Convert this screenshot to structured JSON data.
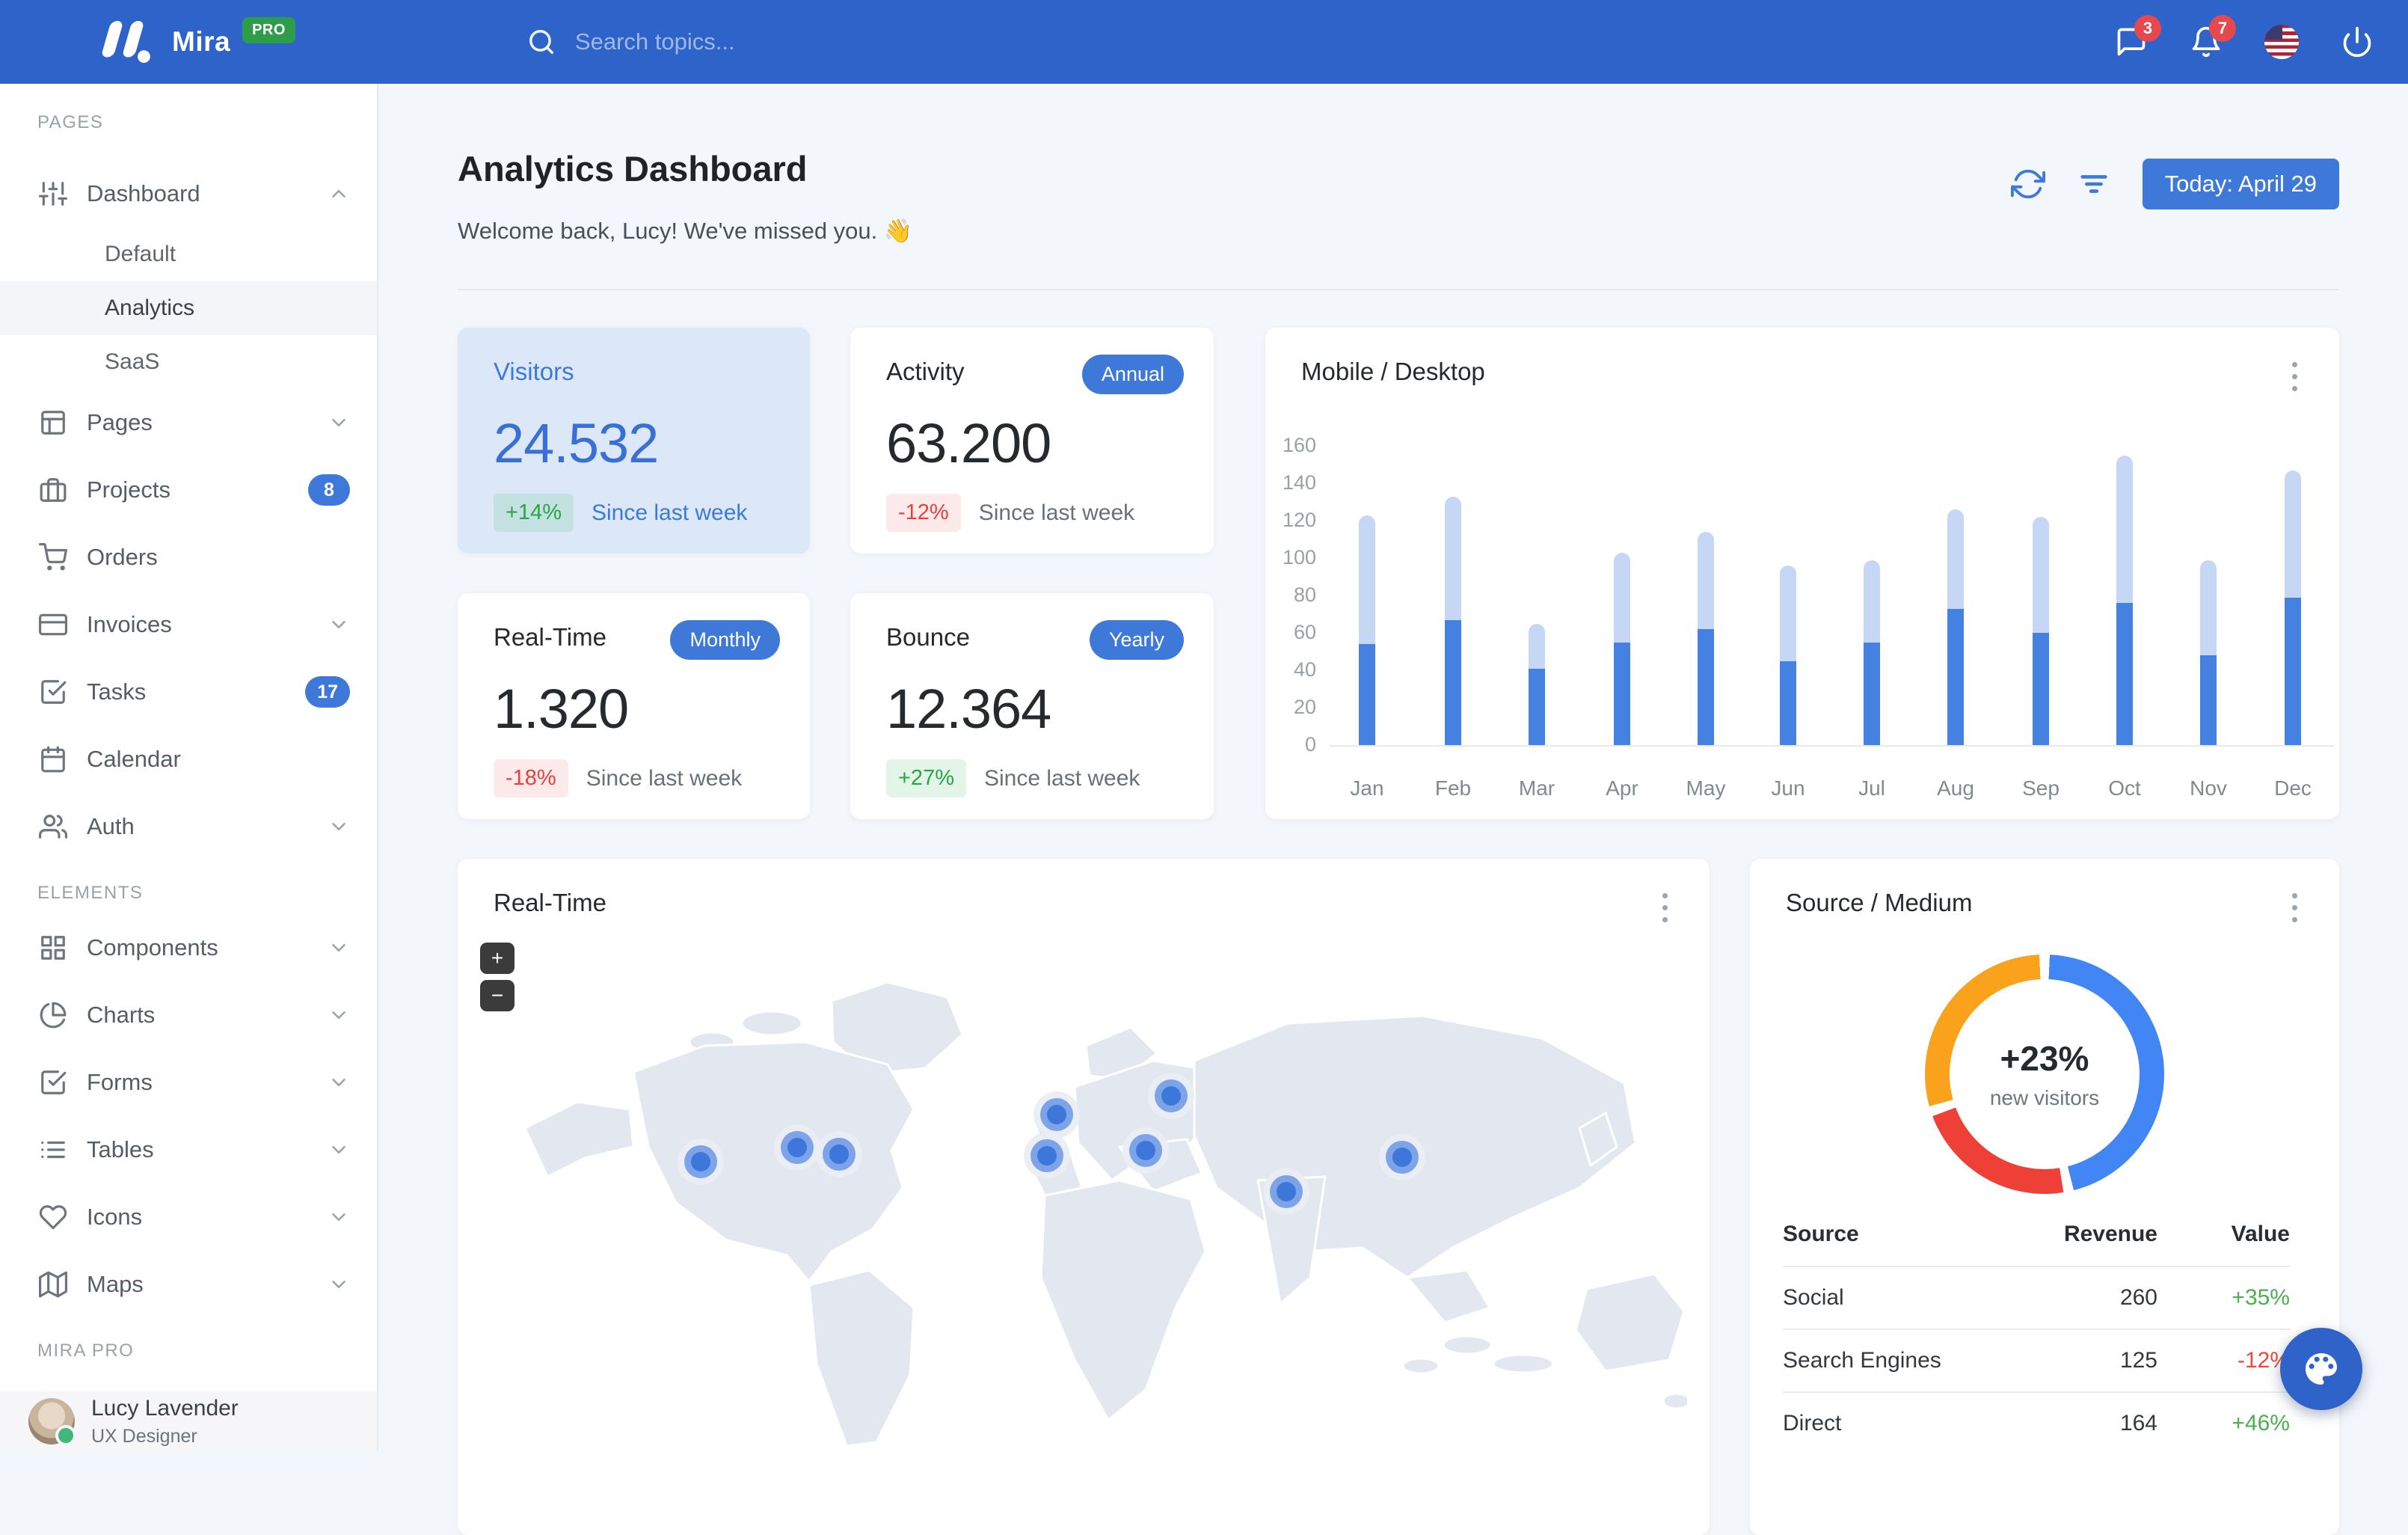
{
  "colors": {
    "navbar": "#2E63C9",
    "primary": "#3E79DA",
    "badge_red": "#E5484D",
    "pro_green": "#2E9D49",
    "positive_green": "#2AA444",
    "negative_red": "#E5413E",
    "table_green": "#4CAF50",
    "table_red": "#EF4837",
    "bar_mobile": "#4581E1",
    "bar_desktop": "#C5D7F4",
    "donut_blue": "#4285F4",
    "donut_red": "#EF4037",
    "donut_orange": "#FAA21B",
    "highlight_card_bg": "#DCE8F8",
    "map_fill": "#E3E8F0"
  },
  "navbar": {
    "brand": "Mira",
    "brand_badge": "PRO",
    "search_placeholder": "Search topics...",
    "messages_badge": "3",
    "notifications_badge": "7",
    "icons": [
      "search-icon",
      "message-square-icon",
      "bell-icon",
      "us-flag-icon",
      "power-icon"
    ]
  },
  "sidebar": {
    "sections": [
      {
        "title": "PAGES",
        "items": [
          {
            "label": "Dashboard",
            "icon": "sliders",
            "expanded": true,
            "children": [
              {
                "label": "Default",
                "active": false
              },
              {
                "label": "Analytics",
                "active": true
              },
              {
                "label": "SaaS",
                "active": false
              }
            ]
          },
          {
            "label": "Pages",
            "icon": "layout",
            "chevron": "down"
          },
          {
            "label": "Projects",
            "icon": "briefcase",
            "badge": "8"
          },
          {
            "label": "Orders",
            "icon": "shopping-cart"
          },
          {
            "label": "Invoices",
            "icon": "credit-card",
            "chevron": "down"
          },
          {
            "label": "Tasks",
            "icon": "check-square",
            "badge": "17"
          },
          {
            "label": "Calendar",
            "icon": "calendar"
          },
          {
            "label": "Auth",
            "icon": "users",
            "chevron": "down"
          }
        ]
      },
      {
        "title": "ELEMENTS",
        "items": [
          {
            "label": "Components",
            "icon": "grid",
            "chevron": "down"
          },
          {
            "label": "Charts",
            "icon": "pie-chart",
            "chevron": "down"
          },
          {
            "label": "Forms",
            "icon": "check-square",
            "chevron": "down"
          },
          {
            "label": "Tables",
            "icon": "list",
            "chevron": "down"
          },
          {
            "label": "Icons",
            "icon": "heart",
            "chevron": "down"
          },
          {
            "label": "Maps",
            "icon": "map",
            "chevron": "down"
          }
        ]
      },
      {
        "title": "MIRA PRO",
        "items": []
      }
    ],
    "user": {
      "name": "Lucy Lavender",
      "role": "UX Designer",
      "status": "online"
    }
  },
  "header": {
    "title": "Analytics Dashboard",
    "subtitle": "Welcome back, Lucy! We've missed you. 👋",
    "date_button": "Today: April 29",
    "icons": [
      "refresh-icon",
      "filter-icon"
    ]
  },
  "stats": [
    {
      "title": "Visitors",
      "value": "24.532",
      "badge": "",
      "delta": "+14%",
      "delta_type": "positive",
      "caption": "Since last week",
      "variant": "highlight"
    },
    {
      "title": "Activity",
      "value": "63.200",
      "badge": "Annual",
      "delta": "-12%",
      "delta_type": "negative",
      "caption": "Since last week",
      "variant": "default"
    },
    {
      "title": "Real-Time",
      "value": "1.320",
      "badge": "Monthly",
      "delta": "-18%",
      "delta_type": "negative",
      "caption": "Since last week",
      "variant": "default"
    },
    {
      "title": "Bounce",
      "value": "12.364",
      "badge": "Yearly",
      "delta": "+27%",
      "delta_type": "positive",
      "caption": "Since last week",
      "variant": "default"
    }
  ],
  "chart_data": [
    {
      "type": "bar",
      "stacked": true,
      "title": "Mobile / Desktop",
      "categories": [
        "Jan",
        "Feb",
        "Mar",
        "Apr",
        "May",
        "Jun",
        "Jul",
        "Aug",
        "Sep",
        "Oct",
        "Nov",
        "Dec"
      ],
      "series": [
        {
          "name": "Mobile",
          "color": "#4581E1",
          "values": [
            54,
            67,
            41,
            55,
            62,
            45,
            55,
            73,
            60,
            76,
            48,
            79
          ]
        },
        {
          "name": "Desktop",
          "color": "#C5D7F4",
          "values": [
            69,
            66,
            24,
            48,
            52,
            51,
            44,
            53,
            62,
            79,
            51,
            68
          ]
        }
      ],
      "xlabel": "",
      "ylabel": "",
      "ylim": [
        0,
        160
      ],
      "yticks": [
        0,
        20,
        40,
        60,
        80,
        100,
        120,
        140,
        160
      ],
      "grid": false,
      "legend": "none"
    },
    {
      "type": "pie",
      "subtype": "donut",
      "title": "Source / Medium",
      "center_value": "+23%",
      "center_label": "new visitors",
      "segments": [
        {
          "label": "Social",
          "value": 260,
          "color": "#4285F4"
        },
        {
          "label": "Search Engines",
          "value": 125,
          "color": "#EF4037"
        },
        {
          "label": "Direct",
          "value": 164,
          "color": "#FAA21B"
        }
      ],
      "legend": "none"
    }
  ],
  "map_card": {
    "title": "Real-Time",
    "zoom_in": "+",
    "zoom_out": "−",
    "markers": [
      {
        "x": 325,
        "y": 405
      },
      {
        "x": 454,
        "y": 386
      },
      {
        "x": 510,
        "y": 395
      },
      {
        "x": 801,
        "y": 342
      },
      {
        "x": 788,
        "y": 397
      },
      {
        "x": 954,
        "y": 317
      },
      {
        "x": 920,
        "y": 390
      },
      {
        "x": 1108,
        "y": 445
      },
      {
        "x": 1263,
        "y": 399
      }
    ]
  },
  "source_table": {
    "title": "Source / Medium",
    "columns": [
      "Source",
      "Revenue",
      "Value"
    ],
    "rows": [
      {
        "source": "Social",
        "revenue": "260",
        "value": "+35%",
        "trend": "up"
      },
      {
        "source": "Search Engines",
        "revenue": "125",
        "value": "-12%",
        "trend": "down"
      },
      {
        "source": "Direct",
        "revenue": "164",
        "value": "+46%",
        "trend": "up"
      }
    ]
  },
  "fab": {
    "icon": "palette-icon"
  }
}
